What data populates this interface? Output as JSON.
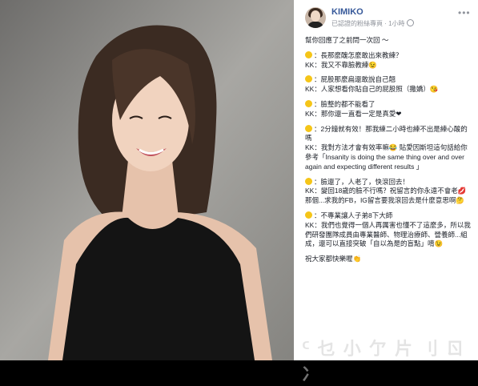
{
  "page": {
    "name": "KIMIKO",
    "subtitle": "已認證的粉絲專頁 · 1小時",
    "more": "•••"
  },
  "post": {
    "intro": "幫你回應了之前問一次回 ～",
    "qas": [
      {
        "q": "：長那麼醜怎麼敢出來教練？",
        "a": "KK：我又不靠臉教練😉"
      },
      {
        "q": "：屁股那麼扁還敢說自己翹",
        "a": "KK：人家想看你貼自己的屁股照（撒嬌）😘"
      },
      {
        "q": "：臉整的都不能看了",
        "a": "KK：那你還一直看一定是真愛❤"
      },
      {
        "q": "：2分鐘就有效！那我練二小時也練不出是練心酸的嗎",
        "a": "KK：我對方法才會有效率嘛😂 貼愛因斯坦這句話給你參考「Insanity is doing the same thing over and over again and expecting different results 」"
      },
      {
        "q": "：臉還了，人老了，快滾回去！",
        "a": "KK：變回18歲的臉不行嗎？祝留言的你永遠不會老💋 那個...求我的FB，IG留言要我滾回去是什麼意思啊🤔"
      },
      {
        "q": "：不專業讓人子弟8下大師",
        "a": "KK：我們也覺得一個人再厲害也懂不了這麼多，所以我們研發團隊成員由專業醫師、物理治療師、營養師...組成，還可以直接突破「自以為是的盲點」唷😉"
      }
    ],
    "outro": "祝大家都快樂喔👏"
  },
  "watermark": "ᑦ 乜 小 亇 片 刂 ㄖ 冫",
  "colors": {
    "link": "#365899",
    "meta": "#90949c",
    "text": "#1d2129",
    "emoji": "#f5c518"
  }
}
